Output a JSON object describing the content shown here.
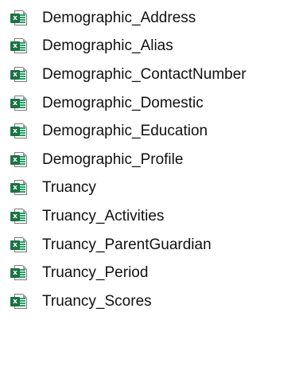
{
  "files": [
    {
      "name": "Demographic_Address",
      "icon": "excel-file-icon"
    },
    {
      "name": "Demographic_Alias",
      "icon": "excel-file-icon"
    },
    {
      "name": "Demographic_ContactNumber",
      "icon": "excel-file-icon"
    },
    {
      "name": "Demographic_Domestic",
      "icon": "excel-file-icon"
    },
    {
      "name": "Demographic_Education",
      "icon": "excel-file-icon"
    },
    {
      "name": "Demographic_Profile",
      "icon": "excel-file-icon"
    },
    {
      "name": "Truancy",
      "icon": "excel-file-icon"
    },
    {
      "name": "Truancy_Activities",
      "icon": "excel-file-icon"
    },
    {
      "name": "Truancy_ParentGuardian",
      "icon": "excel-file-icon"
    },
    {
      "name": "Truancy_Period",
      "icon": "excel-file-icon"
    },
    {
      "name": "Truancy_Scores",
      "icon": "excel-file-icon"
    }
  ],
  "colors": {
    "excel_green": "#1e7145",
    "excel_light_green": "#21a366",
    "text": "#111111"
  }
}
